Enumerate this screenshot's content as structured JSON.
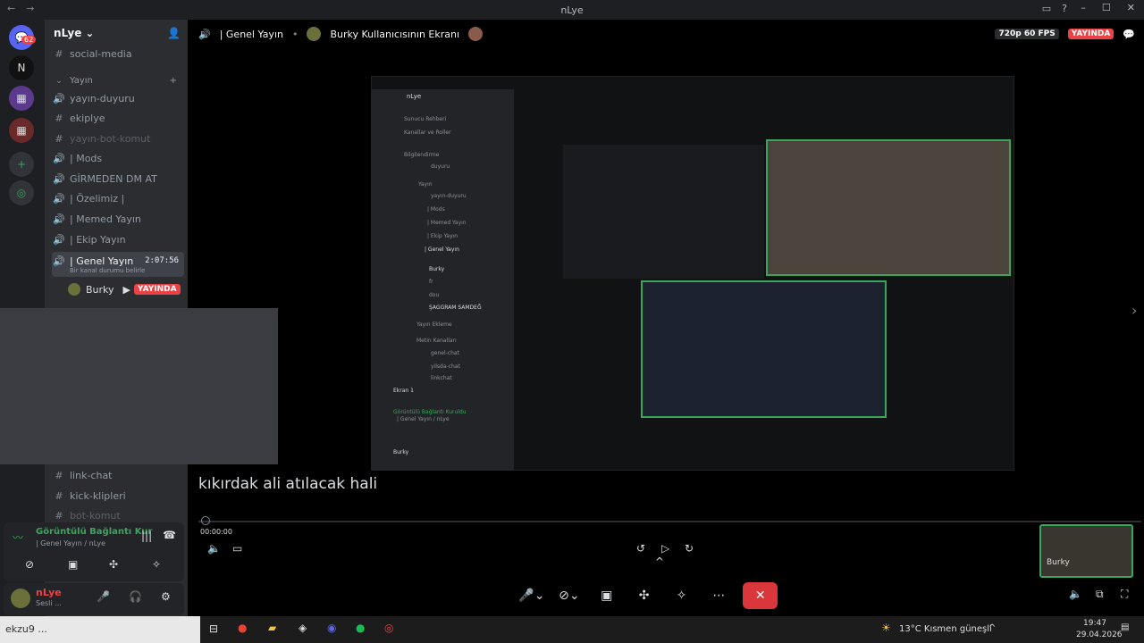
{
  "window": {
    "title": "nLye"
  },
  "server": {
    "name": "nLye",
    "badge": "62"
  },
  "channels": [
    {
      "icon": "#",
      "label": "social-media"
    },
    {
      "icon": "⌄",
      "label": "Yayın"
    },
    {
      "icon": "🔊",
      "label": "yayın-duyuru"
    },
    {
      "icon": "#",
      "label": "ekiplye"
    },
    {
      "icon": "#",
      "label": "yayın-bot-komut"
    },
    {
      "icon": "🔊",
      "label": "| Mods"
    },
    {
      "icon": "🔊",
      "label": "GİRMEDEN DM AT"
    },
    {
      "icon": "🔊",
      "label": "| Özelimiz |"
    },
    {
      "icon": "🔊",
      "label": "| Memed Yayın"
    },
    {
      "icon": "🔊",
      "label": "| Ekip Yayın"
    },
    {
      "icon": "🔊",
      "label": "| Genel Yayın",
      "time": "2:07:56",
      "sub": "Bir kanal durumu belirle"
    },
    {
      "icon": "#",
      "label": "link-chat"
    },
    {
      "icon": "#",
      "label": "kick-klipleri"
    },
    {
      "icon": "#",
      "label": "bot-komut"
    }
  ],
  "voice_user": {
    "name": "Burky",
    "status": "YAYINDA"
  },
  "topbar": {
    "channel": "| Genel Yayın",
    "stream_title": "Burky Kullanıcısının Ekranı",
    "quality": "720p 60 FPS",
    "live": "YAYINDA"
  },
  "caption": "kıkırdak ali atılacak hali",
  "progress": {
    "time": "00:00:00"
  },
  "pip": {
    "name": "Burky",
    "date": "29.04.2026"
  },
  "voice_panel": {
    "title": "Görüntülü Bağlantı Kur",
    "subtitle": "| Genel Yayın / nLye"
  },
  "user_panel": {
    "name": "nLye",
    "status": "Sesli ..."
  },
  "taskbar": {
    "search": "ekzu9 ...",
    "weather": "13°C  Kısmen güneşli",
    "time": "19:47",
    "date": "29.04.2026",
    "notif": "6"
  },
  "inner_screen": {
    "server": "nLye",
    "items": [
      "Sunucu Rehberi",
      "Kanallar ve Roller",
      "Bilgilendirme",
      "duyuru",
      "Yayın",
      "yayın-duyuru",
      "| Mods",
      "| Memed Yayın",
      "| Ekip Yayın",
      "| Genel Yayın",
      "Burky",
      "fr",
      "dou",
      "ŞAGGRAM SAMDEĞ",
      "Yayın Ekleme",
      "Metin Kanalları",
      "genel-chat",
      "yilsda-chat",
      "linkchat"
    ],
    "voice_title": "Görüntülü Bağlantı Kuruldu",
    "voice_sub": "| Genel Yayın / nLye",
    "screen_label": "Ekran 1",
    "user": "Burky"
  },
  "colors": {
    "accent": "#5865f2",
    "live": "#ed4245",
    "green": "#3ba55c",
    "bg": "#000000"
  }
}
